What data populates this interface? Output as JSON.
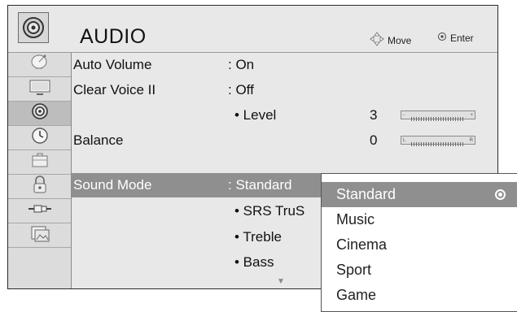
{
  "header": {
    "title": "AUDIO",
    "hint_move": "Move",
    "hint_enter": "Enter"
  },
  "sidebar": {
    "items": [
      {
        "icon": "satellite-dish-icon"
      },
      {
        "icon": "tv-screen-icon"
      },
      {
        "icon": "speaker-icon",
        "active": true
      },
      {
        "icon": "clock-icon"
      },
      {
        "icon": "briefcase-icon"
      },
      {
        "icon": "lock-icon"
      },
      {
        "icon": "input-plug-icon"
      },
      {
        "icon": "photo-icon"
      }
    ]
  },
  "menu": {
    "auto_volume": {
      "label": "Auto Volume",
      "value": ": On"
    },
    "clear_voice": {
      "label": "Clear Voice II",
      "value": ": Off"
    },
    "level": {
      "label": "• Level",
      "value": "3",
      "slider_left": "-",
      "slider_right": "+"
    },
    "balance": {
      "label": "Balance",
      "value": "0",
      "slider_left": "L",
      "slider_right": "R"
    },
    "sound_mode": {
      "label": "Sound Mode",
      "value": ": Standard"
    },
    "srs": {
      "label": "• SRS TruS"
    },
    "treble": {
      "label": "• Treble"
    },
    "bass": {
      "label": "• Bass"
    }
  },
  "popup": {
    "options": [
      "Standard",
      "Music",
      "Cinema",
      "Sport",
      "Game"
    ],
    "selected": "Standard"
  },
  "colors": {
    "selection": "#8f8f8f",
    "panel": "#e8e8e8"
  }
}
